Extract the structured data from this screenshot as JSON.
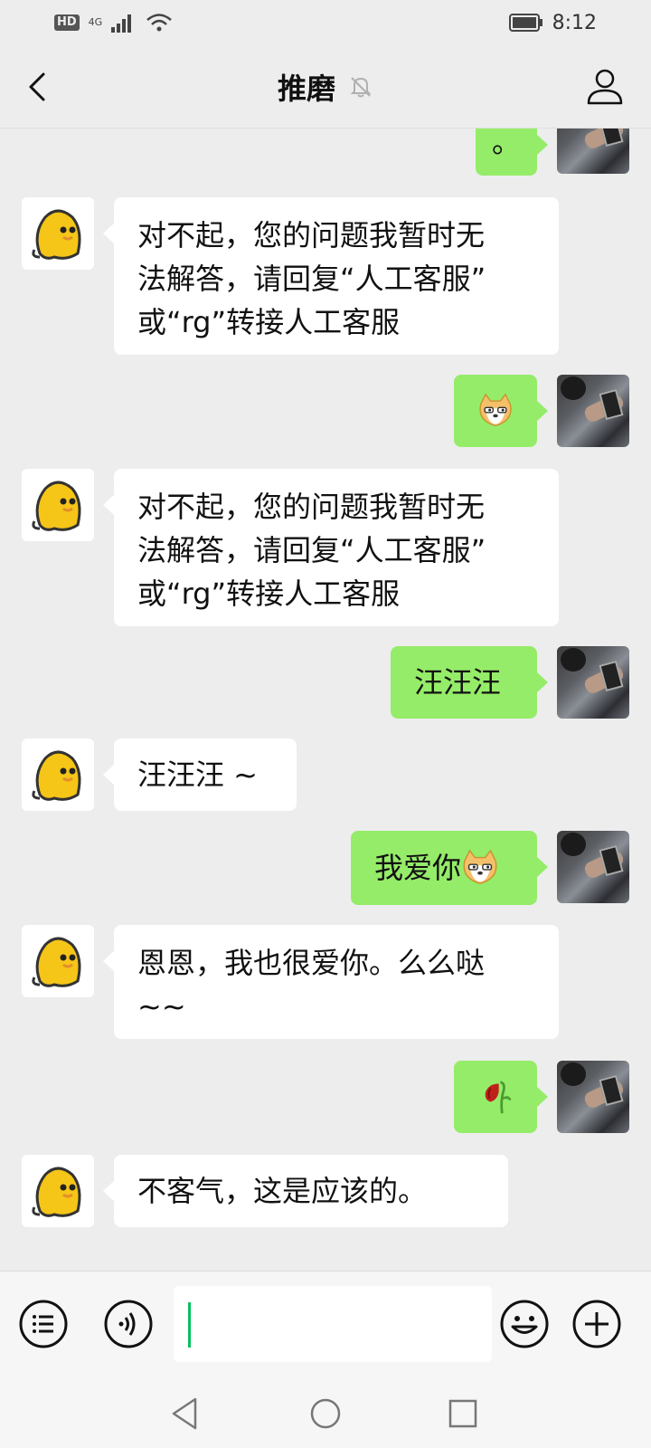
{
  "status_bar": {
    "hd": "HD",
    "network": "4G",
    "time": "8:12"
  },
  "header": {
    "title": "推磨",
    "muted_icon": "bell-off-icon",
    "back_icon": "chevron-left-icon",
    "profile_icon": "person-icon"
  },
  "messages": [
    {
      "side": "right",
      "text": "。"
    },
    {
      "side": "left",
      "lines": [
        "对不起，您的问题我暂时无",
        "法解答，请回复“人工客服”",
        "或“rg”转接人工客服"
      ]
    },
    {
      "side": "right",
      "emoji": "doge-emoji"
    },
    {
      "side": "left",
      "lines": [
        "对不起，您的问题我暂时无",
        "法解答，请回复“人工客服”",
        "或“rg”转接人工客服"
      ]
    },
    {
      "side": "right",
      "text": "汪汪汪"
    },
    {
      "side": "left",
      "lines": [
        "汪汪汪 ~"
      ]
    },
    {
      "side": "right",
      "text": "我爱你",
      "emoji": "doge-emoji"
    },
    {
      "side": "left",
      "lines": [
        "恩恩，我也很爱你。么么哒",
        "~~"
      ]
    },
    {
      "side": "right",
      "emoji": "wilted-rose-emoji"
    },
    {
      "side": "left",
      "lines": [
        "不客气，这是应该的。"
      ]
    }
  ],
  "input_bar": {
    "menu_icon": "list-menu-icon",
    "voice_icon": "voice-icon",
    "input_value": "",
    "emoji_icon": "smiley-icon",
    "plus_icon": "plus-icon"
  },
  "nav_bar": {
    "back_icon": "triangle-back-icon",
    "home_icon": "circle-home-icon",
    "recents_icon": "square-recents-icon"
  },
  "colors": {
    "background": "#ededed",
    "bubble_self": "#95ec69",
    "bubble_other": "#ffffff",
    "caret": "#07c160"
  }
}
